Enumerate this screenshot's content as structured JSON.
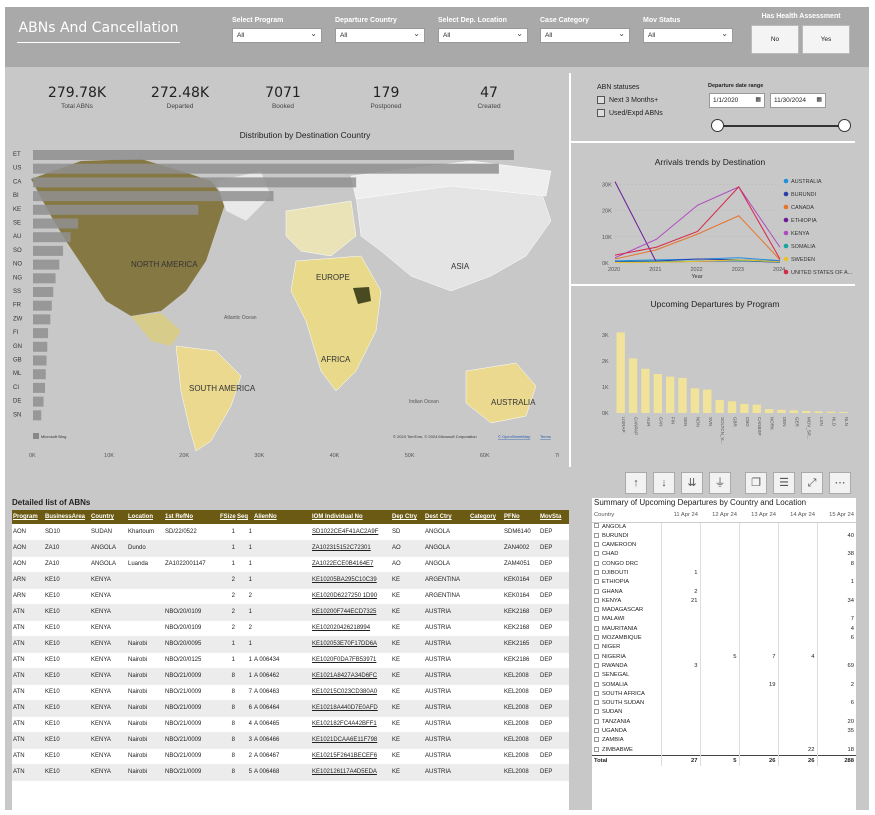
{
  "header": {
    "title": "ABNs And Cancellation",
    "slicers": [
      {
        "label": "Select Program",
        "value": "All"
      },
      {
        "label": "Departure Country",
        "value": "All"
      },
      {
        "label": "Select Dep. Location",
        "value": "All"
      },
      {
        "label": "Case Category",
        "value": "All"
      },
      {
        "label": "Mov Status",
        "value": "All"
      }
    ],
    "health": {
      "label": "Has Health Assessment",
      "no": "No",
      "yes": "Yes"
    }
  },
  "kpis": [
    {
      "value": "279.78K",
      "label": "Total ABNs"
    },
    {
      "value": "272.48K",
      "label": "Departed"
    },
    {
      "value": "7071",
      "label": "Booked"
    },
    {
      "value": "179",
      "label": "Postponed"
    },
    {
      "value": "47",
      "label": "Created"
    }
  ],
  "abn_statuses": {
    "title": "ABN statuses",
    "options": [
      "Next 3 Months+",
      "Used/Expd ABNs"
    ]
  },
  "date_range": {
    "label": "Departure date range",
    "start": "1/1/2020",
    "end": "11/30/2024",
    "fill_fraction": 1.0
  },
  "map": {
    "title": "Distribution by Destination Country",
    "labels": [
      "NORTH AMERICA",
      "EUROPE",
      "ASIA",
      "AFRICA",
      "SOUTH AMERICA",
      "AUSTRALIA",
      "Atlantic Ocean",
      "Indian Ocean"
    ],
    "logo": "Microsoft Bing",
    "attribution": "© 2024 TomTom, © 2024 Microsoft Corporation",
    "attribution_link1": "© OpenStreetMap",
    "attribution_link2": "Terms"
  },
  "toolbar": {
    "icons": [
      "arrow-up-icon",
      "arrow-down-icon",
      "double-arrow-down-icon",
      "hierarchy-icon",
      "copy-icon",
      "filter-icon",
      "focus-mode-icon",
      "more-options-icon"
    ],
    "glyphs": [
      "↑",
      "↓",
      "⇊",
      "⏚",
      "❐",
      "☰",
      "⤢",
      "⋯"
    ]
  },
  "chart_data": [
    {
      "type": "bar",
      "orientation": "horizontal",
      "title": "Distribution by Destination Country",
      "categories": [
        "ET",
        "US",
        "CA",
        "BI",
        "KE",
        "SE",
        "AU",
        "SO",
        "NO",
        "NG",
        "SS",
        "FR",
        "ZW",
        "FI",
        "GN",
        "GB",
        "ML",
        "CI",
        "DE",
        "SN"
      ],
      "values": [
        64000,
        62000,
        43000,
        32000,
        22000,
        6000,
        5000,
        4000,
        3500,
        3000,
        2700,
        2500,
        2300,
        2000,
        1900,
        1800,
        1700,
        1600,
        1400,
        1100
      ],
      "xlim": [
        0,
        70000
      ],
      "xticks": [
        "0K",
        "10K",
        "20K",
        "30K",
        "40K",
        "50K",
        "60K",
        "70K"
      ]
    },
    {
      "type": "line",
      "title": "Arrivals trends by Destination",
      "xlabel": "Year",
      "x": [
        2020,
        2021,
        2022,
        2023,
        2024
      ],
      "yticks": [
        "0K",
        "10K",
        "20K",
        "30K"
      ],
      "ylim": [
        0,
        32000
      ],
      "legend_position": "right",
      "series": [
        {
          "name": "AUSTRALIA",
          "color": "#1f8fe0",
          "values": [
            800,
            1200,
            1500,
            2000,
            900
          ]
        },
        {
          "name": "BURUNDI",
          "color": "#2a3fa8",
          "values": [
            500,
            700,
            1500,
            1200,
            600
          ]
        },
        {
          "name": "CANADA",
          "color": "#e8742a",
          "values": [
            1500,
            5000,
            11000,
            18000,
            1200
          ]
        },
        {
          "name": "ETHIOPIA",
          "color": "#6a1b9a",
          "values": [
            31000,
            400,
            600,
            800,
            300
          ]
        },
        {
          "name": "KENYA",
          "color": "#b04ac0",
          "values": [
            2000,
            9000,
            22000,
            29000,
            6000
          ]
        },
        {
          "name": "SOMALIA",
          "color": "#18a5a0",
          "values": [
            300,
            500,
            700,
            900,
            400
          ]
        },
        {
          "name": "SWEDEN",
          "color": "#e8c22a",
          "values": [
            200,
            300,
            600,
            1200,
            500
          ]
        },
        {
          "name": "UNITED STATES OF A...",
          "color": "#d6284b",
          "values": [
            3000,
            6000,
            12000,
            29000,
            1500
          ]
        }
      ]
    },
    {
      "type": "bar",
      "title": "Upcoming Departures by Program",
      "categories": [
        "USRAP",
        "CANPAP",
        "AUR",
        "CAN",
        "FIN",
        "SEN",
        "NDN",
        "SVN",
        "SOLTCN_V...",
        "GBR",
        "CBG",
        "CANBSP",
        "NORK",
        "DEN",
        "GER",
        "MOV_SP...",
        "LXN",
        "NLD",
        "NLN"
      ],
      "values": [
        3100,
        2100,
        1700,
        1500,
        1400,
        1350,
        950,
        900,
        500,
        450,
        350,
        320,
        150,
        120,
        100,
        80,
        60,
        50,
        40
      ],
      "ylim": [
        0,
        3500
      ],
      "yticks": [
        "0K",
        "1K",
        "2K",
        "3K"
      ]
    }
  ],
  "detail_table": {
    "title": "Detailed list of ABNs",
    "columns": [
      "Program",
      "BusinessArea",
      "Country",
      "Location",
      "1st RefNo",
      "FSize",
      "Seq",
      "AlienNo",
      "IOM Individual No",
      "Dep Ctry",
      "Dest Ctry",
      "Category",
      "PFNo",
      "MovSta"
    ],
    "rows": [
      [
        "AON",
        "SD10",
        "SUDAN",
        "Khartoum",
        "SD/22/0522",
        "1",
        "1",
        "",
        "SD1022CE4F41AC2A9F",
        "SD",
        "ANGOLA",
        "",
        "SDM6140",
        "DEP"
      ],
      [
        "AON",
        "ZA10",
        "ANGOLA",
        "Dundo",
        "",
        "1",
        "1",
        "",
        "ZA102315152C72301",
        "AO",
        "ANGOLA",
        "",
        "ZAN4002",
        "DEP"
      ],
      [
        "AON",
        "ZA10",
        "ANGOLA",
        "Luanda",
        "ZA1022001147",
        "1",
        "1",
        "",
        "ZA1022ECE0B4164E7",
        "AO",
        "ANGOLA",
        "",
        "ZAM4051",
        "DEP"
      ],
      [
        "ARN",
        "KE10",
        "KENYA",
        "",
        "",
        "2",
        "1",
        "",
        "KE10205BA295C10C39",
        "KE",
        "ARGENTINA",
        "",
        "KEK0164",
        "DEP"
      ],
      [
        "ARN",
        "KE10",
        "KENYA",
        "",
        "",
        "2",
        "2",
        "",
        "KE1020D6227250 1D90",
        "KE",
        "ARGENTINA",
        "",
        "KEK0164",
        "DEP"
      ],
      [
        "ATN",
        "KE10",
        "KENYA",
        "",
        "NBO/20/0109",
        "2",
        "1",
        "",
        "KE10200F744ECD7325",
        "KE",
        "AUSTRIA",
        "",
        "KEK2168",
        "DEP"
      ],
      [
        "ATN",
        "KE10",
        "KENYA",
        "",
        "NBO/20/0109",
        "2",
        "2",
        "",
        "KE102020426218994",
        "KE",
        "AUSTRIA",
        "",
        "KEK2168",
        "DEP"
      ],
      [
        "ATN",
        "KE10",
        "KENYA",
        "Nairobi",
        "NBO/20/0095",
        "1",
        "1",
        "",
        "KE102053E70F17DD6A",
        "KE",
        "AUSTRIA",
        "",
        "KEK2165",
        "DEP"
      ],
      [
        "ATN",
        "KE10",
        "KENYA",
        "Nairobi",
        "NBO/20/0125",
        "1",
        "1",
        "A 006434",
        "KE1020F0DA7FB53971",
        "KE",
        "AUSTRIA",
        "",
        "KEK2186",
        "DEP"
      ],
      [
        "ATN",
        "KE10",
        "KENYA",
        "Nairobi",
        "NBO/21/0009",
        "8",
        "1",
        "A 006462",
        "KE1021A8427A34D6FC",
        "KE",
        "AUSTRIA",
        "",
        "KEL2008",
        "DEP"
      ],
      [
        "ATN",
        "KE10",
        "KENYA",
        "Nairobi",
        "NBO/21/0009",
        "8",
        "7",
        "A 006463",
        "KE10215C023CD380A0",
        "KE",
        "AUSTRIA",
        "",
        "KEL2008",
        "DEP"
      ],
      [
        "ATN",
        "KE10",
        "KENYA",
        "Nairobi",
        "NBO/21/0009",
        "8",
        "6",
        "A 006464",
        "KE10218A440D7E0AFD",
        "KE",
        "AUSTRIA",
        "",
        "KEL2008",
        "DEP"
      ],
      [
        "ATN",
        "KE10",
        "KENYA",
        "Nairobi",
        "NBO/21/0009",
        "8",
        "4",
        "A 006465",
        "KE102182FC4A42BFF1",
        "KE",
        "AUSTRIA",
        "",
        "KEL2008",
        "DEP"
      ],
      [
        "ATN",
        "KE10",
        "KENYA",
        "Nairobi",
        "NBO/21/0009",
        "8",
        "3",
        "A 006466",
        "KE1021DCAA6E11F798",
        "KE",
        "AUSTRIA",
        "",
        "KEL2008",
        "DEP"
      ],
      [
        "ATN",
        "KE10",
        "KENYA",
        "Nairobi",
        "NBO/21/0009",
        "8",
        "2",
        "A 006467",
        "KE10215F2641BECEF6",
        "KE",
        "AUSTRIA",
        "",
        "KEL2008",
        "DEP"
      ],
      [
        "ATN",
        "KE10",
        "KENYA",
        "Nairobi",
        "NBO/21/0009",
        "8",
        "5",
        "A 006468",
        "KE102126117A4D5EDA",
        "KE",
        "AUSTRIA",
        "",
        "KEL2008",
        "DEP"
      ]
    ]
  },
  "summary_table": {
    "title": "Summary of Upcoming Departures by Country and Location",
    "columns": [
      "Country",
      "11 Apr 24",
      "12 Apr 24",
      "13 Apr 24",
      "14 Apr 24",
      "15 Apr 24"
    ],
    "rows": [
      [
        "ANGOLA",
        "",
        "",
        "",
        "",
        ""
      ],
      [
        "BURUNDI",
        "",
        "",
        "",
        "",
        "40"
      ],
      [
        "CAMEROON",
        "",
        "",
        "",
        "",
        ""
      ],
      [
        "CHAD",
        "",
        "",
        "",
        "",
        "38"
      ],
      [
        "CONGO DRC",
        "",
        "",
        "",
        "",
        "8"
      ],
      [
        "DJIBOUTI",
        "1",
        "",
        "",
        "",
        ""
      ],
      [
        "ETHIOPIA",
        "",
        "",
        "",
        "",
        "1"
      ],
      [
        "GHANA",
        "2",
        "",
        "",
        "",
        ""
      ],
      [
        "KENYA",
        "21",
        "",
        "",
        "",
        "34"
      ],
      [
        "MADAGASCAR",
        "",
        "",
        "",
        "",
        ""
      ],
      [
        "MALAWI",
        "",
        "",
        "",
        "",
        "7"
      ],
      [
        "MAURITANIA",
        "",
        "",
        "",
        "",
        "4"
      ],
      [
        "MOZAMBIQUE",
        "",
        "",
        "",
        "",
        "6"
      ],
      [
        "NIGER",
        "",
        "",
        "",
        "",
        ""
      ],
      [
        "NIGERIA",
        "",
        "5",
        "7",
        "4",
        ""
      ],
      [
        "RWANDA",
        "3",
        "",
        "",
        "",
        "69"
      ],
      [
        "SENEGAL",
        "",
        "",
        "",
        "",
        ""
      ],
      [
        "SOMALIA",
        "",
        "",
        "19",
        "",
        "2"
      ],
      [
        "SOUTH AFRICA",
        "",
        "",
        "",
        "",
        ""
      ],
      [
        "SOUTH SUDAN",
        "",
        "",
        "",
        "",
        "6"
      ],
      [
        "SUDAN",
        "",
        "",
        "",
        "",
        ""
      ],
      [
        "TANZANIA",
        "",
        "",
        "",
        "",
        "20"
      ],
      [
        "UGANDA",
        "",
        "",
        "",
        "",
        "35"
      ],
      [
        "ZAMBIA",
        "",
        "",
        "",
        "",
        ""
      ],
      [
        "ZIMBABWE",
        "",
        "",
        "",
        "22",
        "18"
      ]
    ],
    "total": [
      "Total",
      "27",
      "5",
      "26",
      "26",
      "288"
    ]
  }
}
